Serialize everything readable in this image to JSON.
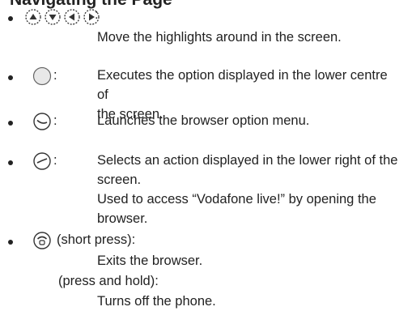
{
  "heading": "Navigating the Page",
  "items": [
    {
      "keys": [
        "up-key",
        "down-key",
        "left-key",
        "right-key"
      ],
      "suffix": ":",
      "lines": [
        "Move the highlights around in the screen."
      ]
    },
    {
      "keys": [
        "centre-key"
      ],
      "suffix": ":",
      "lines": [
        "Executes the option displayed in the lower centre of",
        "the screen."
      ]
    },
    {
      "keys": [
        "left-soft-key"
      ],
      "suffix": ":",
      "lines": [
        "Launches the browser option menu."
      ]
    },
    {
      "keys": [
        "right-soft-key"
      ],
      "suffix": ":",
      "lines": [
        "Selects an action displayed in the lower right of the",
        "screen.",
        "Used to access “Vodafone live!” by opening the",
        "browser."
      ]
    },
    {
      "keys": [
        "end-key"
      ],
      "short_label": "(short press):",
      "short_desc": "Exits the browser.",
      "hold_label": "(press and hold):",
      "hold_desc": "Turns off the phone."
    }
  ]
}
